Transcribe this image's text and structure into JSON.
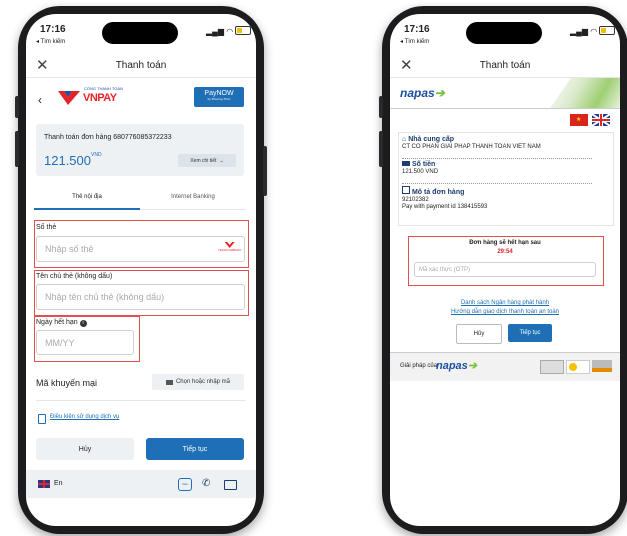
{
  "left": {
    "status_time": "17:16",
    "back_app": "◂ Tìm kiếm",
    "nav_title": "Thanh toán",
    "brand_small": "CỔNG THANH TOÁN",
    "brand": "VNPAY",
    "paynow_label": "PayNOW",
    "paynow_sub": "by Phương Thức",
    "order_label": "Thanh toán đơn hàng 680776085372233",
    "amount": "121.500",
    "currency": "VND",
    "details_label": "Xem chi tiết",
    "tab_domestic": "Thẻ nội địa",
    "tab_ibanking": "Internet Banking",
    "card_label": "Số thẻ",
    "card_placeholder": "Nhập số thẻ",
    "bank_logo": "TECHCOMBANK",
    "holder_label": "Tên chủ thẻ (không dấu)",
    "holder_placeholder": "Nhập tên chủ thẻ (không dấu)",
    "expiry_label": "Ngày hết hạn",
    "expiry_placeholder": "MM/YY",
    "promo_label": "Mã khuyến mại",
    "promo_button": "Chọn hoặc nhập mã",
    "terms_link": "Điều kiện sử dụng dịch vụ",
    "cancel_button": "Hủy",
    "continue_button": "Tiếp tục",
    "lang": "En",
    "zalo_label": "Zalo"
  },
  "right": {
    "status_time": "17:16",
    "back_app": "◂ Tìm kiếm",
    "nav_title": "Thanh toán",
    "brand": "napas",
    "provider_label": "Nhà cung cấp",
    "provider_value": "CT CO PHAN GIAI PHAP THANH TOAN VIET NAM",
    "amount_label": "Số tiền",
    "amount_value": "121.500 VND",
    "desc_label": "Mô tả đơn hàng",
    "desc_value_1": "92102382",
    "desc_value_2": "Pay with payment id 138415593",
    "expire_label": "Đơn hàng sẽ hết hạn sau",
    "countdown": "29:54",
    "otp_placeholder": "Mã xác thực (OTP)",
    "bank_list_link": "Danh sách Ngân hàng phát hành",
    "safe_guide_link": "Hướng dẫn giao dịch thanh toán an toàn",
    "cancel_button": "Hủy",
    "continue_button": "Tiếp tục",
    "footer_label": "Giải pháp của",
    "footer_brand": "napas"
  },
  "colors": {
    "primary_blue": "#1e6fb5",
    "vnpay_red": "#e52329",
    "napas_blue": "#1b4fa0",
    "napas_green": "#7cc242",
    "error_red": "#e05050"
  }
}
